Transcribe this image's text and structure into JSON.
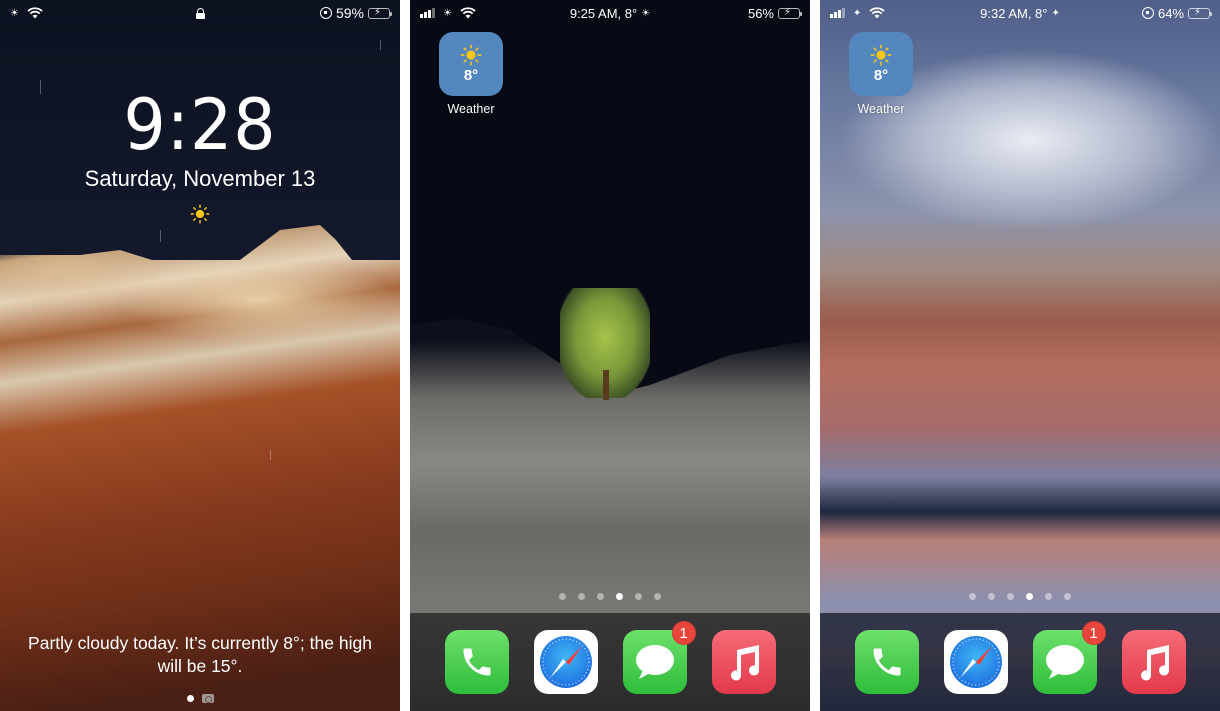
{
  "screens": [
    {
      "type": "lock-screen",
      "status_bar": {
        "left_icons": [
          "brightness-icon",
          "wifi-icon"
        ],
        "center_icon": "lock-icon",
        "right_icons": [
          "orientation-lock-icon"
        ],
        "battery_percent": "59%",
        "battery_level": 0.59,
        "charging": true
      },
      "time": "9:28",
      "date": "Saturday, November 13",
      "weather_icon": "sun-icon",
      "forecast": "Partly cloudy today. It’s currently 8°; the high will be 15°.",
      "page_indicator": [
        "dot",
        "camera-icon"
      ]
    },
    {
      "type": "home-screen",
      "status_bar": {
        "left_icons": [
          "cellular-signal-icon",
          "brightness-icon",
          "wifi-icon"
        ],
        "center_text": "9:25 AM, 8°",
        "center_icon": "sun-icon",
        "battery_percent": "56%",
        "battery_level": 0.56,
        "charging": true
      },
      "weather_app": {
        "label": "Weather",
        "temp": "8°",
        "icon": "sun-icon",
        "color": "#5487bd"
      },
      "pages": 6,
      "active_page": 4,
      "dock": [
        {
          "name": "Phone",
          "icon": "phone-icon"
        },
        {
          "name": "Safari",
          "icon": "compass-icon"
        },
        {
          "name": "Messages",
          "icon": "chat-bubble-icon",
          "badge": "1"
        },
        {
          "name": "Music",
          "icon": "music-note-icon"
        }
      ]
    },
    {
      "type": "home-screen",
      "status_bar": {
        "left_icons": [
          "cellular-signal-icon",
          "brightness-icon",
          "wifi-icon"
        ],
        "center_text": "9:32 AM, 8°",
        "center_icon": "star-icon",
        "right_icons": [
          "orientation-lock-icon"
        ],
        "battery_percent": "64%",
        "battery_level": 0.64,
        "charging": true
      },
      "weather_app": {
        "label": "Weather",
        "temp": "8°",
        "icon": "sun-icon",
        "color": "#5487bd"
      },
      "pages": 6,
      "active_page": 4,
      "dock": [
        {
          "name": "Phone",
          "icon": "phone-icon"
        },
        {
          "name": "Safari",
          "icon": "compass-icon"
        },
        {
          "name": "Messages",
          "icon": "chat-bubble-icon",
          "badge": "1"
        },
        {
          "name": "Music",
          "icon": "music-note-icon"
        }
      ]
    }
  ],
  "colors": {
    "weather_tile": "#5487bd",
    "badge": "#e8453c",
    "battery_charging": "#4cd964",
    "sun": "#f5c518"
  }
}
